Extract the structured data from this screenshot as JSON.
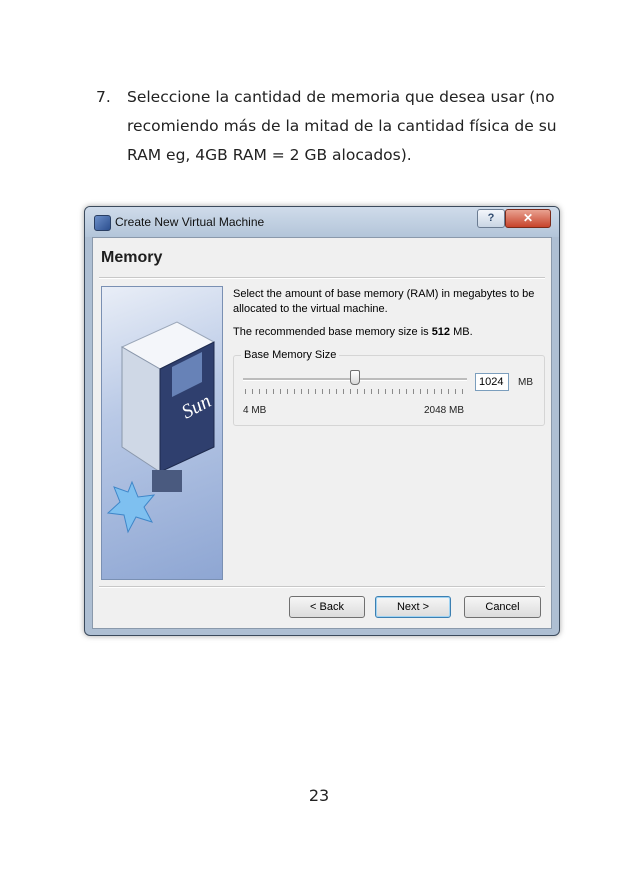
{
  "instruction": {
    "number": "7.",
    "text": "Seleccione la cantidad de memoria que desea usar (no recomiendo más de la mitad de la cantidad física de su RAM eg, 4GB RAM = 2 GB alocados)."
  },
  "dialog": {
    "title": "Create New Virtual Machine",
    "help_label": "?",
    "close_label": "✕",
    "heading": "Memory",
    "description": "Select the amount of base memory (RAM) in megabytes to be allocated to the virtual machine.",
    "recommended_prefix": "The recommended base memory size is ",
    "recommended_value": "512",
    "recommended_suffix": " MB.",
    "group_label": "Base Memory Size",
    "slider": {
      "min_label": "4 MB",
      "max_label": "2048 MB",
      "value_mb": 1024,
      "min_mb": 4,
      "max_mb": 2048
    },
    "input_value": "1024",
    "unit": "MB",
    "side_image_text": "Sun",
    "buttons": {
      "back": "< Back",
      "next": "Next >",
      "cancel": "Cancel"
    }
  },
  "page_number": "23"
}
